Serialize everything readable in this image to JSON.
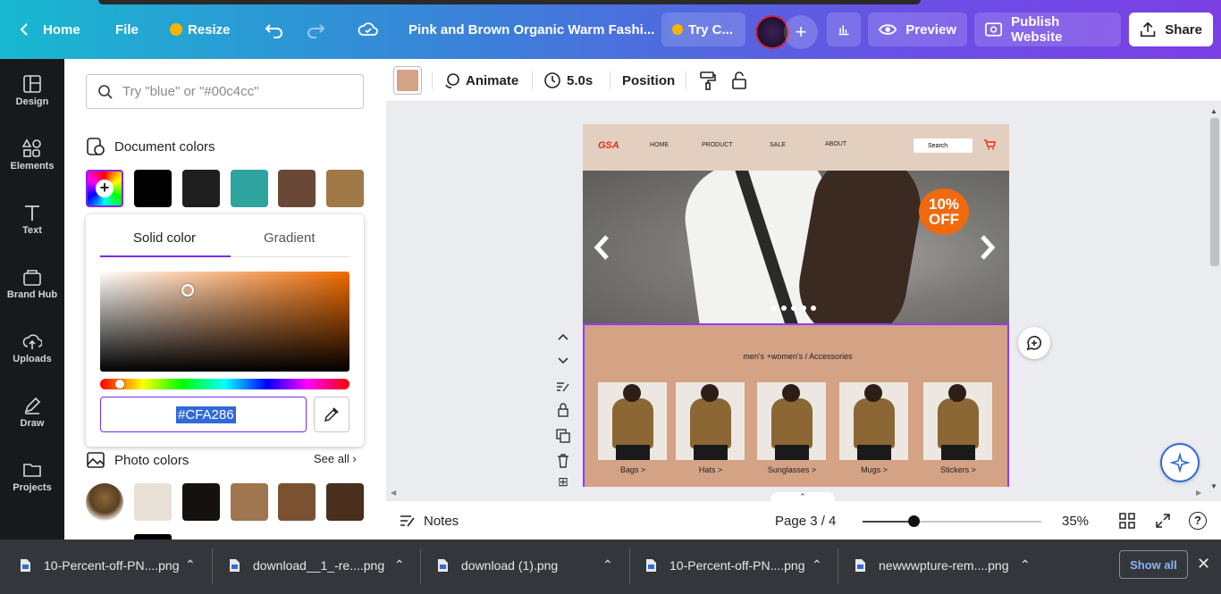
{
  "topbar": {
    "home": "Home",
    "file": "File",
    "resize": "Resize",
    "doc_title": "Pink and Brown Organic Warm Fashi...",
    "try_label": "Try C...",
    "preview": "Preview",
    "publish": "Publish Website",
    "share": "Share"
  },
  "rail": {
    "items": [
      {
        "label": "Design"
      },
      {
        "label": "Elements"
      },
      {
        "label": "Text"
      },
      {
        "label": "Brand Hub"
      },
      {
        "label": "Uploads"
      },
      {
        "label": "Draw"
      },
      {
        "label": "Projects"
      }
    ]
  },
  "panel": {
    "search_placeholder": "Try \"blue\" or \"#00c4cc\"",
    "document_colors_title": "Document colors",
    "document_colors": [
      "#000000",
      "#1f1f1f",
      "#2fa49f",
      "#6a4838",
      "#a07948"
    ],
    "picker": {
      "tab_solid": "Solid color",
      "tab_gradient": "Gradient",
      "hex_value": "#CFA286"
    },
    "photo_colors_title": "Photo colors",
    "see_all": "See all",
    "photo_colors": [
      "#e6e0d6",
      "#14110e",
      "#a07650",
      "#7a5232",
      "#4a2e1e"
    ]
  },
  "toolbar": {
    "fill_color": "#d4a285",
    "animate": "Animate",
    "duration": "5.0s",
    "position": "Position"
  },
  "design": {
    "brand": "GSA",
    "nav": [
      "HOME",
      "PRODUCT",
      "SALE",
      "ABOUT"
    ],
    "search": "Search",
    "badge_line1": "10%",
    "badge_line2": "OFF",
    "category_line": "men's +women's / Accessories",
    "products": [
      "Bags >",
      "Hats >",
      "Sunglasses >",
      "Mugs >",
      "Stickers >"
    ]
  },
  "status": {
    "notes": "Notes",
    "page": "Page 3 / 4",
    "zoom": "35%",
    "zoom_level": 0.35
  },
  "downloads": {
    "files": [
      "10-Percent-off-PN....png",
      "download__1_-re....png",
      "download (1).png",
      "10-Percent-off-PN....png",
      "newwwpture-rem....png"
    ],
    "show_all": "Show all"
  }
}
